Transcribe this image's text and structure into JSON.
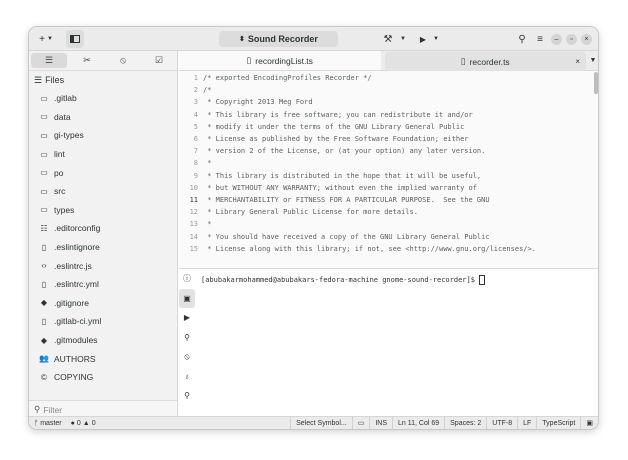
{
  "header": {
    "add_label": "+",
    "title": "Sound Recorder"
  },
  "sidebar": {
    "tabs": [
      "☰",
      "✂",
      "⦸",
      "☑"
    ],
    "files_title": "Files",
    "items": [
      {
        "icon": "folder-icon",
        "glyph": "▭",
        "label": ".gitlab"
      },
      {
        "icon": "folder-icon",
        "glyph": "▭",
        "label": "data"
      },
      {
        "icon": "folder-icon",
        "glyph": "▭",
        "label": "gi-types"
      },
      {
        "icon": "folder-icon",
        "glyph": "▭",
        "label": "lint"
      },
      {
        "icon": "folder-icon",
        "glyph": "▭",
        "label": "po"
      },
      {
        "icon": "folder-icon",
        "glyph": "▭",
        "label": "src"
      },
      {
        "icon": "folder-icon",
        "glyph": "▭",
        "label": "types"
      },
      {
        "icon": "config-file-icon",
        "glyph": "☷",
        "label": ".editorconfig"
      },
      {
        "icon": "file-icon",
        "glyph": "▯",
        "label": ".eslintignore"
      },
      {
        "icon": "code-file-icon",
        "glyph": "‹›",
        "label": ".eslintrc.js"
      },
      {
        "icon": "file-icon",
        "glyph": "▯",
        "label": ".eslintrc.yml"
      },
      {
        "icon": "git-icon",
        "glyph": "◆",
        "label": ".gitignore"
      },
      {
        "icon": "file-icon",
        "glyph": "▯",
        "label": ".gitlab-ci.yml"
      },
      {
        "icon": "git-icon",
        "glyph": "◆",
        "label": ".gitmodules"
      },
      {
        "icon": "people-icon",
        "glyph": "👥",
        "label": "AUTHORS"
      },
      {
        "icon": "copyright-icon",
        "glyph": "©",
        "label": "COPYING"
      }
    ],
    "filter_placeholder": "Filter"
  },
  "tabs": [
    {
      "label": "recordingList.ts",
      "active": true
    },
    {
      "label": "recorder.ts",
      "active": false
    }
  ],
  "code": {
    "current_line": 11,
    "lines": [
      "/* exported EncodingProfiles Recorder */",
      "/*",
      " * Copyright 2013 Meg Ford",
      " * This library is free software; you can redistribute it and/or",
      " * modify it under the terms of the GNU Library General Public",
      " * License as published by the Free Software Foundation; either",
      " * version 2 of the License, or (at your option) any later version.",
      " *",
      " * This library is distributed in the hope that it will be useful,",
      " * but WITHOUT ANY WARRANTY; without even the implied warranty of",
      " * MERCHANTABILITY or FITNESS FOR A PARTICULAR PURPOSE.  See the GNU",
      " * Library General Public License for more details.",
      " *",
      " * You should have received a copy of the GNU Library General Public",
      " * License along with this library; if not, see <http://www.gnu.org/licenses/>."
    ]
  },
  "terminal": {
    "prompt": "[abubakarmohammed@abubakars-fedora-machine gnome-sound-recorder]$ "
  },
  "status": {
    "branch": "master",
    "errors": "0",
    "warnings": "0",
    "symbol": "Select Symbol...",
    "mode": "INS",
    "position": "Ln 11, Col 69",
    "spaces": "Spaces: 2",
    "encoding": "UTF-8",
    "line_ending": "LF",
    "language": "TypeScript"
  }
}
